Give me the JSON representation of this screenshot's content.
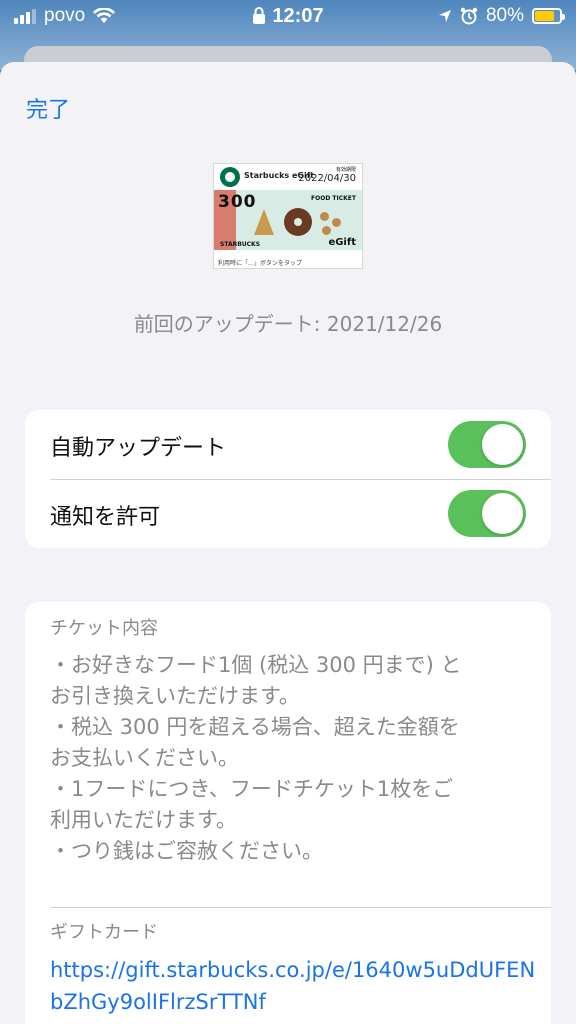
{
  "status": {
    "carrier": "povo",
    "time": "12:07",
    "battery": "80%",
    "battery_color": "#ffcc00"
  },
  "header": {
    "done_label": "完了"
  },
  "pass": {
    "brand": "Starbucks eGift",
    "expiry_label": "有効期限",
    "expiry": "2022/04/30",
    "amount": "300",
    "food_ticket": "FOOD TICKET",
    "starbucks": "STARBUCKS",
    "egift": "eGift",
    "footer": "利用時に「…」ボタンをタップ"
  },
  "updated": "前回のアップデート: 2021/12/26",
  "settings": {
    "auto_update_label": "自動アップデート",
    "auto_update_on": true,
    "notify_label": "通知を許可",
    "notify_on": true,
    "toggle_color": "#5ac05a"
  },
  "ticket": {
    "title": "チケット内容",
    "lines": [
      "・お好きなフード1個 (税込 300 円まで) と",
      "お引き換えいただけます。",
      "・税込 300 円を超える場合、超えた金額を",
      "お支払いください。",
      "・1フードにつき、フードチケット1枚をご",
      "利用いただけます。",
      "・つり銭はご容赦ください。"
    ]
  },
  "gift": {
    "title": "ギフトカード",
    "url": "https://gift.starbucks.co.jp/e/1640w5uDdUFENbZhGy9olIFlrzSrTTNf"
  }
}
